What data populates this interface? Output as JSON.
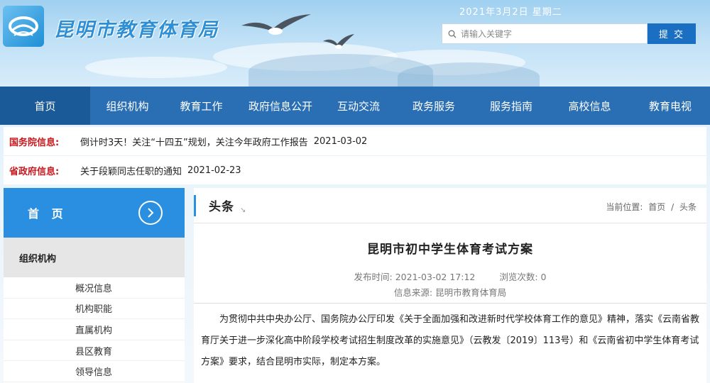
{
  "header": {
    "site_title": "昆明市教育体育局",
    "date": "2021年3月2日 星期二",
    "search_placeholder": "请输入关键字",
    "submit_label": "提 交"
  },
  "nav": {
    "items": [
      {
        "label": "首页"
      },
      {
        "label": "组织机构"
      },
      {
        "label": "教育工作"
      },
      {
        "label": "政府信息公开"
      },
      {
        "label": "互动交流"
      },
      {
        "label": "政务服务"
      },
      {
        "label": "服务指南"
      },
      {
        "label": "高校信息"
      },
      {
        "label": "教育电视"
      }
    ]
  },
  "info": {
    "state_council": {
      "label": "国务院信息:",
      "text": "倒计时3天！关注“十四五”规划，关注今年政府工作报告",
      "date": "2021-03-02"
    },
    "province": {
      "label": "省政府信息:",
      "text": "关于段颖同志任职的通知",
      "date": "2021-02-23"
    }
  },
  "sidebar": {
    "home_label": "首 页",
    "section_label": "组织机构",
    "items": [
      {
        "label": "概况信息"
      },
      {
        "label": "机构职能"
      },
      {
        "label": "直属机构"
      },
      {
        "label": "县区教育"
      },
      {
        "label": "领导信息"
      }
    ]
  },
  "main": {
    "section_title": "头条",
    "breadcrumb_prefix": "当前位置:",
    "breadcrumb_home": "首页",
    "breadcrumb_sep": "/",
    "breadcrumb_current": "头条",
    "article_title": "昆明市初中学生体育考试方案",
    "publish_label": "发布时间:",
    "publish_time": "2021-03-02 17:12",
    "views_label": "浏览次数:",
    "views": "0",
    "source_label": "信息来源:",
    "source": "昆明市教育体育局",
    "body": "为贯彻中共中央办公厅、国务院办公厅印发《关于全面加强和改进新时代学校体育工作的意见》精神，落实《云南省教育厅关于进一步深化高中阶段学校考试招生制度改革的实施意见》（云教发〔2019〕113号）和《云南省初中学生体育考试方案》要求，结合昆明市实际，制定本方案。"
  },
  "colors": {
    "nav_bg": "#2a6fb4",
    "nav_active": "#1b5a98",
    "accent_blue": "#2a8fe0",
    "submit_bg": "#1a6fc2",
    "info_label_red": "#c8161d"
  }
}
